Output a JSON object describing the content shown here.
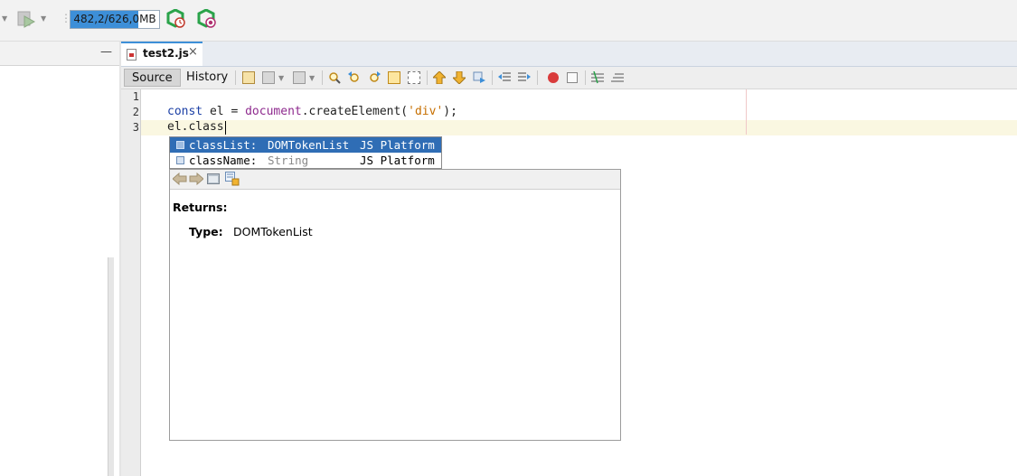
{
  "toolbar": {
    "memory_label": "482,2/626,0MB",
    "memory_used_fraction": 0.77
  },
  "editor": {
    "tab_label": "test2.js",
    "tab_close": "×",
    "source_label": "Source",
    "history_label": "History",
    "line_numbers": [
      "1",
      "2",
      "3"
    ],
    "line2": {
      "kw": "const",
      "pre": " el = ",
      "obj": "document",
      "mid": ".createElement(",
      "str": "'div'",
      "post": ");"
    },
    "line3": "el.class"
  },
  "completion": {
    "items": [
      {
        "name": "classList:",
        "type": "DOMTokenList",
        "origin": "JS Platform",
        "selected": true
      },
      {
        "name": "className:",
        "type": "String",
        "origin": "JS Platform",
        "selected": false
      }
    ]
  },
  "doc": {
    "returns_label": "Returns:",
    "type_label": "Type:",
    "type_value": "DOMTokenList"
  },
  "colors": {
    "accent": "#3d8fd8",
    "selection": "#2f6db5",
    "keyword": "#1b3fa5",
    "object": "#8e2a8e",
    "string": "#c66f00"
  },
  "icons": [
    "run-project-icon",
    "profile-icon",
    "debug-icon",
    "file-js-icon",
    "minimize-icon",
    "close-icon",
    "back-icon",
    "forward-icon",
    "search-icon",
    "toggle-comment-icon",
    "record-macro-icon",
    "stop-macro-icon"
  ]
}
